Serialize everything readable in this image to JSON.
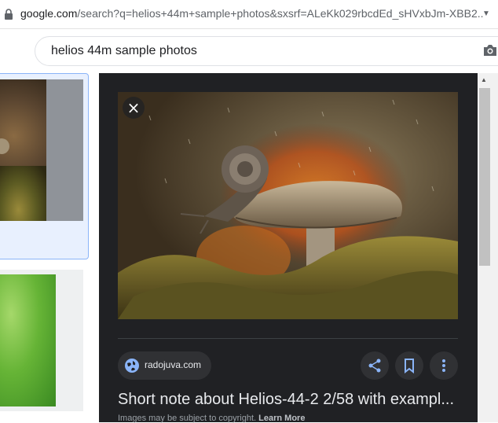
{
  "address_bar": {
    "domain": "google.com",
    "path": "/search?q=helios+44m+sample+photos&sxsrf=ALeKk029rbcdEd_sHVxbJm-XBB2..."
  },
  "search": {
    "query": "helios 44m sample photos"
  },
  "preview": {
    "source_name": "radojuva.com",
    "title": "Short note about Helios-44-2 2/58 with exampl...",
    "copyright_text": "Images may be subject to copyright.",
    "learn_more_label": "Learn More",
    "close_label": "×"
  },
  "icons": {
    "lock": "lock-icon",
    "camera": "camera-icon",
    "globe": "globe-icon",
    "share": "share-icon",
    "save": "bookmark-icon",
    "more": "more-vert-icon",
    "close": "close-icon"
  },
  "colors": {
    "panel_bg": "#202124",
    "chip_bg": "#303134",
    "accent_blue": "#8ab4f8",
    "text_light": "#e8eaed"
  }
}
